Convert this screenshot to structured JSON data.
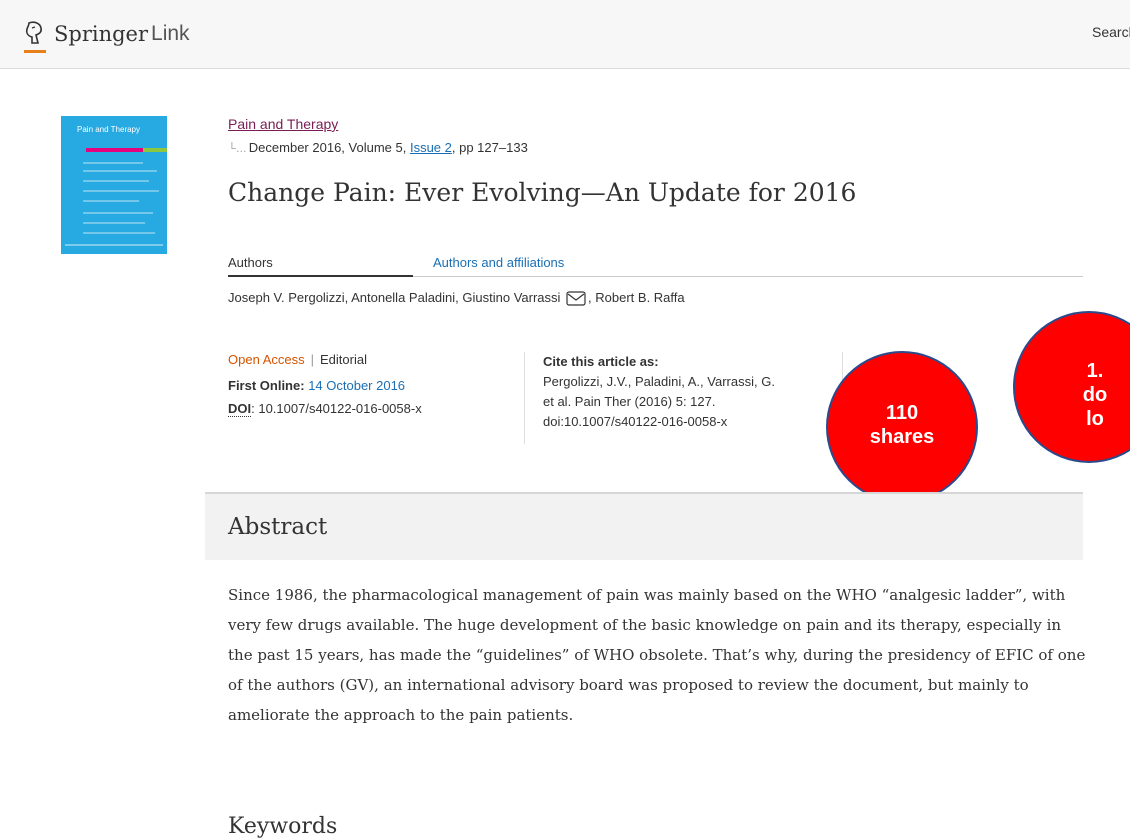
{
  "header": {
    "brand_primary": "Springer",
    "brand_secondary": "Link",
    "search_label": "Search"
  },
  "cover": {
    "title": "Pain and Therapy"
  },
  "article": {
    "journal": "Pain and Therapy",
    "date_volume": "December 2016, Volume 5,",
    "issue": "Issue 2",
    "pages": ", pp 127–133",
    "title": "Change Pain: Ever Evolving—An Update for 2016",
    "tabs": [
      "Authors",
      "Authors and affiliations"
    ],
    "authors_part1": "Joseph V. Pergolizzi, Antonella Paladini, Giustino Varrassi",
    "authors_part2": ", Robert B. Raffa",
    "open_access": "Open Access",
    "type": "Editorial",
    "first_online_label": "First Online:",
    "first_online_date": "14 October 2016",
    "doi_label": "DOI",
    "doi_value": ": 10.1007/s40122-016-0058-x",
    "cite_heading": "Cite this article as:",
    "cite_lines": [
      "Pergolizzi, J.V., Paladini, A., Varrassi, G.",
      "et al. Pain Ther (2016) 5: 127.",
      "doi:10.1007/s40122-016-0058-x"
    ]
  },
  "badges": {
    "shares_value": "110",
    "shares_label": "shares",
    "downloads_line1": "1.",
    "downloads_line2": "do",
    "downloads_line3": "lo"
  },
  "abstract": {
    "heading": "Abstract",
    "text": "Since 1986, the pharmacological management of pain was mainly based on the WHO “analgesic ladder”, with very few drugs available. The huge development of the basic knowledge on pain and its therapy, especially in the past 15 years, has made the “guidelines” of WHO obsolete. That’s why, during the presidency of EFIC of one of the authors (GV), an international advisory board was proposed to review the document, but mainly to ameliorate the approach to the pain patients."
  },
  "keywords": {
    "heading": "Keywords"
  },
  "colors": {
    "badge_fill": "#ff0000",
    "link_blue": "#1a6fb4",
    "journal_link": "#7a1d54",
    "open_access": "#d35400"
  }
}
